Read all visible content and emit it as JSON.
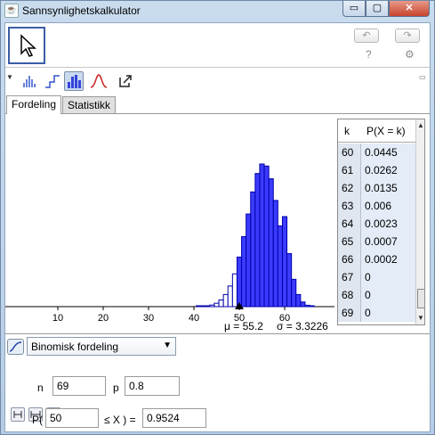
{
  "window": {
    "title": "Sannsynlighetskalkulator",
    "minimize": "▭",
    "maximize": "▢",
    "close": "✕",
    "app_icon": "java-icon"
  },
  "toolbar": {
    "help": "?",
    "settings": "⚙"
  },
  "tabs": [
    {
      "label": "Fordeling"
    },
    {
      "label": "Statistikk"
    }
  ],
  "graph": {
    "mean_label": "μ = 55.2",
    "sd_label": "σ = 3.3226",
    "x_ticks": [
      "10",
      "20",
      "30",
      "40",
      "50",
      "60"
    ]
  },
  "table": {
    "col_k": "k",
    "col_p": "P(X = k)",
    "rows": [
      {
        "k": "60",
        "p": "0.0445"
      },
      {
        "k": "61",
        "p": "0.0262"
      },
      {
        "k": "62",
        "p": "0.0135"
      },
      {
        "k": "63",
        "p": "0.006"
      },
      {
        "k": "64",
        "p": "0.0023"
      },
      {
        "k": "65",
        "p": "0.0007"
      },
      {
        "k": "66",
        "p": "0.0002"
      },
      {
        "k": "67",
        "p": "0"
      },
      {
        "k": "68",
        "p": "0"
      },
      {
        "k": "69",
        "p": "0"
      }
    ]
  },
  "distribution": {
    "selected": "Binomisk fordeling"
  },
  "params": {
    "n_label": "n",
    "n_value": "69",
    "p_label": "p",
    "p_value": "0.8"
  },
  "probability": {
    "prefix": "P(",
    "lower": "50",
    "relation": "≤ X ) =",
    "result": "0.9524"
  },
  "chart_data": {
    "type": "bar",
    "title": "",
    "xlabel": "",
    "ylabel": "",
    "xlim": [
      0,
      69
    ],
    "x_ticks": [
      10,
      20,
      30,
      40,
      50,
      60
    ],
    "series": [
      {
        "name": "",
        "x": [
          39,
          40,
          41,
          42,
          43,
          44,
          45,
          46,
          47,
          48,
          49,
          50,
          51,
          52,
          53,
          54,
          55,
          56,
          57,
          58,
          59,
          60,
          61,
          62,
          63,
          64,
          65,
          66,
          67,
          68,
          69
        ],
        "values": [
          0.0,
          0.0,
          0.0001,
          0.0002,
          0.0004,
          0.0008,
          0.0017,
          0.0033,
          0.006,
          0.0102,
          0.0162,
          0.0245,
          0.0346,
          0.0458,
          0.0567,
          0.0658,
          0.0705,
          0.0695,
          0.0632,
          0.0525,
          0.0399,
          0.0445,
          0.0262,
          0.0135,
          0.006,
          0.0023,
          0.0007,
          0.0002,
          0,
          0,
          0
        ]
      }
    ],
    "highlight_range": [
      50,
      69
    ],
    "colors": {
      "highlight": "#3b3bff",
      "outline": "#0000aa",
      "unhighlighted": "#ffffff"
    }
  }
}
